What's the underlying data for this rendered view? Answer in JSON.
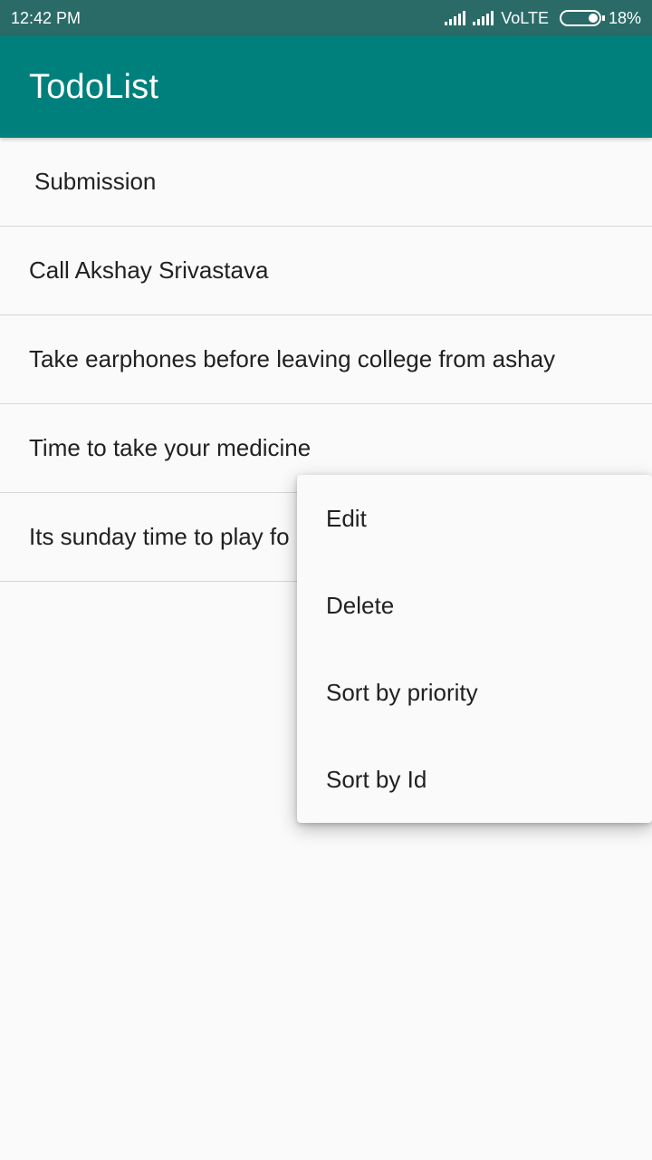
{
  "status_bar": {
    "time": "12:42 PM",
    "network": "VoLTE",
    "battery": "18%",
    "icons": [
      "signal-icon",
      "signal-icon",
      "battery-icon"
    ]
  },
  "app_bar": {
    "title": "TodoList",
    "color": "#00807c"
  },
  "todos": [
    {
      "text": "Submission"
    },
    {
      "text": "Call Akshay Srivastava"
    },
    {
      "text": "Take earphones before leaving college from ashay"
    },
    {
      "text": "Time to take your medicine"
    },
    {
      "text": "Its sunday time to play fo"
    }
  ],
  "context_menu": {
    "items": [
      {
        "label": "Edit"
      },
      {
        "label": "Delete"
      },
      {
        "label": "Sort by priority"
      },
      {
        "label": "Sort by Id"
      }
    ]
  }
}
